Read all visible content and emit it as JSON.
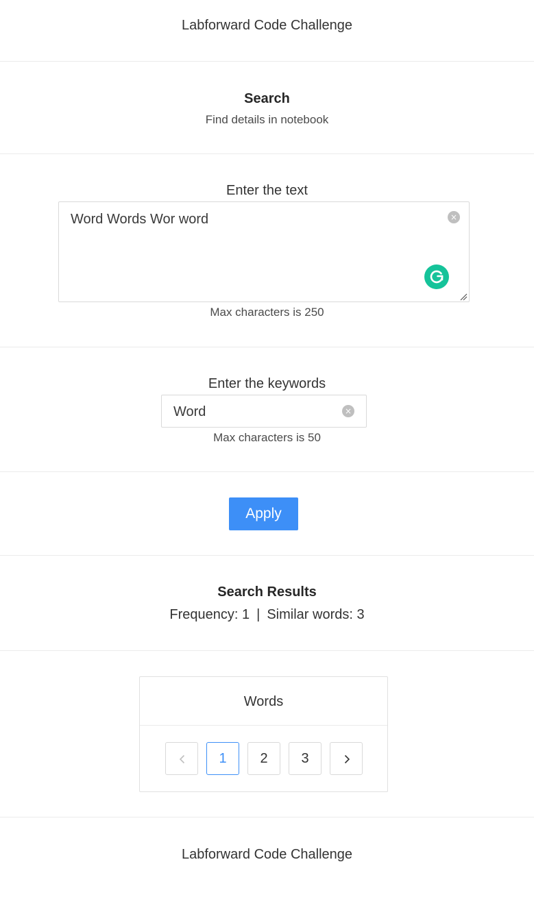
{
  "header": {
    "title": "Labforward Code Challenge"
  },
  "search": {
    "heading": "Search",
    "subtitle": "Find details in notebook"
  },
  "text_field": {
    "label": "Enter the text",
    "value": "Word Words Wor word",
    "helper": "Max characters is 250",
    "clear_icon": "×"
  },
  "keywords_field": {
    "label": "Enter the keywords",
    "value": "Word",
    "helper": "Max characters is 50",
    "clear_icon": "×"
  },
  "apply_button": {
    "label": "Apply"
  },
  "results": {
    "heading": "Search Results",
    "frequency_label": "Frequency: 1",
    "separator": "|",
    "similar_label": "Similar words: 3"
  },
  "words_card": {
    "title": "Words",
    "pagination": {
      "pages": [
        "1",
        "2",
        "3"
      ],
      "current_page": 1,
      "prev_icon": "chevron-left-icon",
      "next_icon": "chevron-right-icon"
    }
  },
  "footer": {
    "title": "Labforward Code Challenge"
  },
  "colors": {
    "accent": "#3d8ff7",
    "grammarly": "#15c39a",
    "border": "#d9d9d9",
    "divider": "#ebebeb"
  }
}
